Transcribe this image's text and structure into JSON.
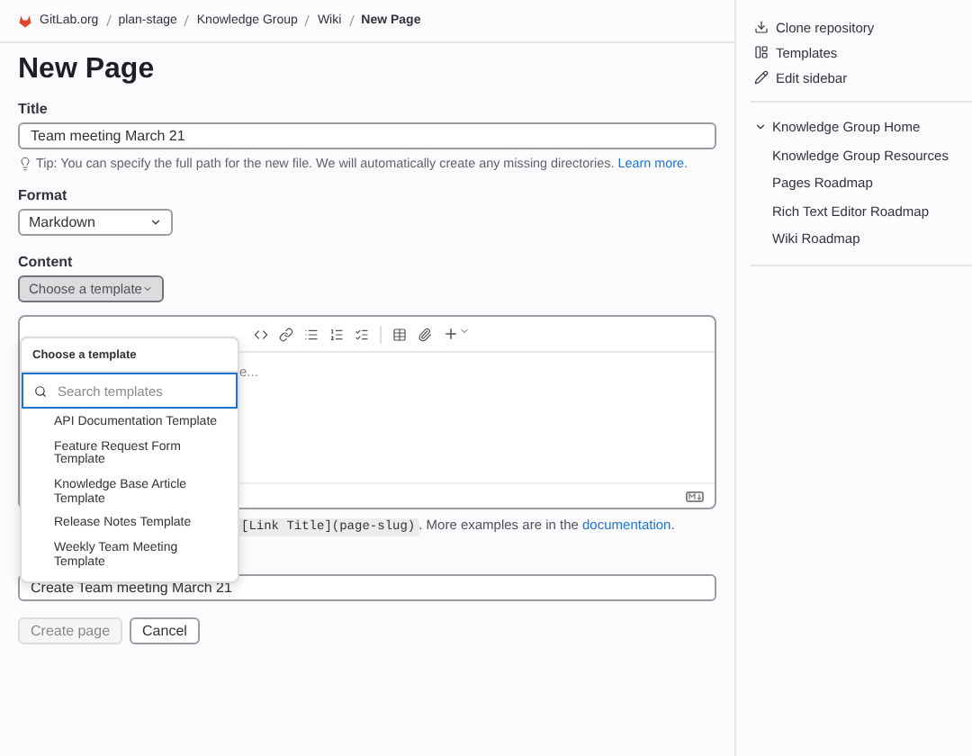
{
  "breadcrumbs": [
    {
      "label": "GitLab.org",
      "current": false
    },
    {
      "label": "plan-stage",
      "current": false
    },
    {
      "label": "Knowledge Group",
      "current": false
    },
    {
      "label": "Wiki",
      "current": false
    },
    {
      "label": "New Page",
      "current": true
    }
  ],
  "heading": "New Page",
  "title_field": {
    "label": "Title",
    "value": "Team meeting March 21",
    "tip": "Tip: You can specify the full path for the new file. We will automatically create any missing directories.",
    "tip_link": "Learn more."
  },
  "format_field": {
    "label": "Format",
    "value": "Markdown"
  },
  "content": {
    "label": "Content",
    "template_button": "Choose a template",
    "editor_placeholder": "e...",
    "help_code": "[Link Title](page-slug)",
    "help_text": ". More examples are in the",
    "help_link": "documentation",
    "help_end": "."
  },
  "template_menu": {
    "title": "Choose a template",
    "search_placeholder": "Search templates",
    "items": [
      {
        "label": "API Documentation Template",
        "selected": false
      },
      {
        "label": "Feature Request Form Template",
        "selected": false
      },
      {
        "label": "Knowledge Base Article Template",
        "selected": false
      },
      {
        "label": "Release Notes Template",
        "selected": false
      },
      {
        "label": "Weekly Team Meeting Template",
        "selected": false
      }
    ]
  },
  "commit_field": {
    "value": "Create Team meeting March 21"
  },
  "buttons": [
    {
      "label": "Create page",
      "disabled": true
    },
    {
      "label": "Cancel",
      "disabled": false
    }
  ],
  "sidebar": {
    "actions": [
      {
        "kind": "download",
        "label": "Clone repository"
      },
      {
        "kind": "layout",
        "label": "Templates"
      },
      {
        "kind": "pencil",
        "label": "Edit sidebar"
      }
    ],
    "tree": [
      {
        "label": "Knowledge Group Home",
        "expanded": true,
        "children": [
          {
            "label": "Knowledge Group Resources"
          },
          {
            "label": "Pages Roadmap"
          },
          {
            "label": "Rich Text Editor Roadmap"
          },
          {
            "label": "Wiki Roadmap"
          }
        ]
      }
    ]
  }
}
